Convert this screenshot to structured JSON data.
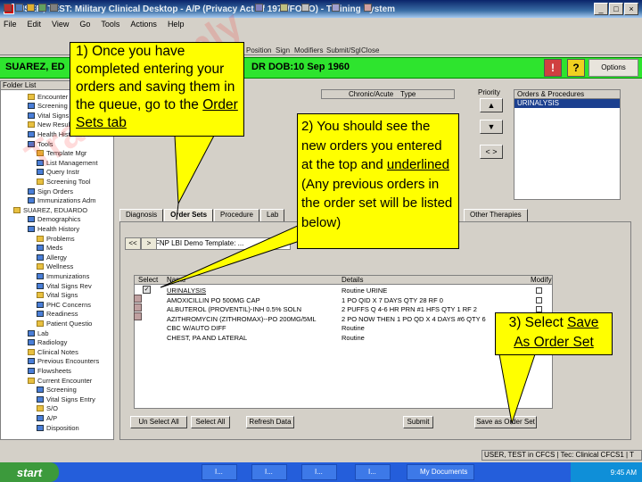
{
  "window": {
    "title": "USER, TEST: Military Clinical Desktop - A/P (Privacy Act of 1974/FOUO) - Training System",
    "min_label": "_",
    "max_label": "□",
    "close_label": "×"
  },
  "menu": [
    "File",
    "Edit",
    "View",
    "Go",
    "Tools",
    "Actions",
    "Help"
  ],
  "toolbar": {
    "buttons": [
      "Position",
      "Sign",
      "Modifiers",
      "Submit/Sgl",
      "Close"
    ],
    "options_label": "Options"
  },
  "patient": {
    "name": "SUAREZ, ED",
    "dob": "DR  DOB:10 Sep 1960",
    "alerts": [
      "!",
      "?"
    ]
  },
  "folder": {
    "header": "Folder List",
    "items": [
      "Encounter",
      "Screening",
      "Vital Signs",
      "New Results",
      "Health Hist",
      "Tools",
      "Template Mgr",
      "List Management",
      "Query Instr",
      "Screening Tool",
      "Sign Orders",
      "Immunizations Adm",
      "SUAREZ, EDUARDO",
      "Demographics",
      "Health History",
      "Problems",
      "Meds",
      "Allergy",
      "Wellness",
      "Immunizations",
      "Vital Signs Rev",
      "Vital Signs",
      "PHC Concerns",
      "Readiness",
      "Patient Questio",
      "Lab",
      "Radiology",
      "Clinical Notes",
      "Previous Encounters",
      "Flowsheets",
      "Current Encounter",
      "Screening",
      "Vital Signs Entry",
      "S/O",
      "A/P",
      "Disposition"
    ]
  },
  "upper": {
    "chronic_label": "Chronic/Acute",
    "type_label": "Type",
    "priority_label": "Priority",
    "orders_header": "Orders & Procedures",
    "selected_order": "URINALYSIS",
    "btn_up": "▲",
    "btn_down": "▼",
    "btn_swap": "< >"
  },
  "tabs": [
    "Diagnosis",
    "Order Sets",
    "Procedure",
    "Lab",
    "Other Therapies"
  ],
  "order_set": {
    "prev": "<<",
    "next": ">",
    "combo_value": "FNP LBI Demo Template: ...",
    "table_headers": [
      "Select",
      "Name",
      "Details",
      "Modify"
    ],
    "rows": [
      {
        "name": "URINALYSIS",
        "details": "Routine  URINE"
      },
      {
        "name": "AMOXICILLIN  PO  500MG  CAP",
        "details": "1  PO QID X 7 DAYS  QTY 28  RF 0"
      },
      {
        "name": "ALBUTEROL (PROVENTIL)-INH 0.5% SOLN",
        "details": "2 PUFFS Q 4-6 HR PRN #1 HFS  QTY 1  RF 2"
      },
      {
        "name": "AZITHROMYCIN (ZITHROMAX)--PO 200MG/5ML",
        "details": "2 PO NOW THEN 1 PO QD X 4 DAYS #6 QTY 6"
      },
      {
        "name": "CBC W/AUTO DIFF",
        "details": "Routine"
      },
      {
        "name": "CHEST, PA AND LATERAL",
        "details": "Routine"
      }
    ],
    "buttons": [
      "Un Select All",
      "Select All",
      "Refresh Data",
      "Submit",
      "Save as Order Set"
    ]
  },
  "status_strip": "USER, TEST in CFCS  |  Tec: Clinical CFCS1  |  T",
  "taskbar": {
    "start": "start",
    "items": [
      "I...",
      "I...",
      "I...",
      "I...",
      "My Documents"
    ],
    "clock": "9:45 AM"
  },
  "watermark": "Training Only",
  "callouts": {
    "c1": "1) Once you have completed entering your orders and saving them in the queue, go to the",
    "c1_link": "Order Sets tab",
    "c2": "2) You should see the new orders you entered at the top and",
    "c2_underlined": "underlined",
    "c2_rest": "(Any previous orders in the order set will be listed below)",
    "c3_prefix": "3)  Select",
    "c3_link1": "Save",
    "c3_link2": "As Order Set"
  },
  "colors": {
    "patient_bar": "#2ee42e",
    "callout": "#ffff00",
    "taskbar": "#245edb",
    "selection": "#1b3f8f"
  }
}
